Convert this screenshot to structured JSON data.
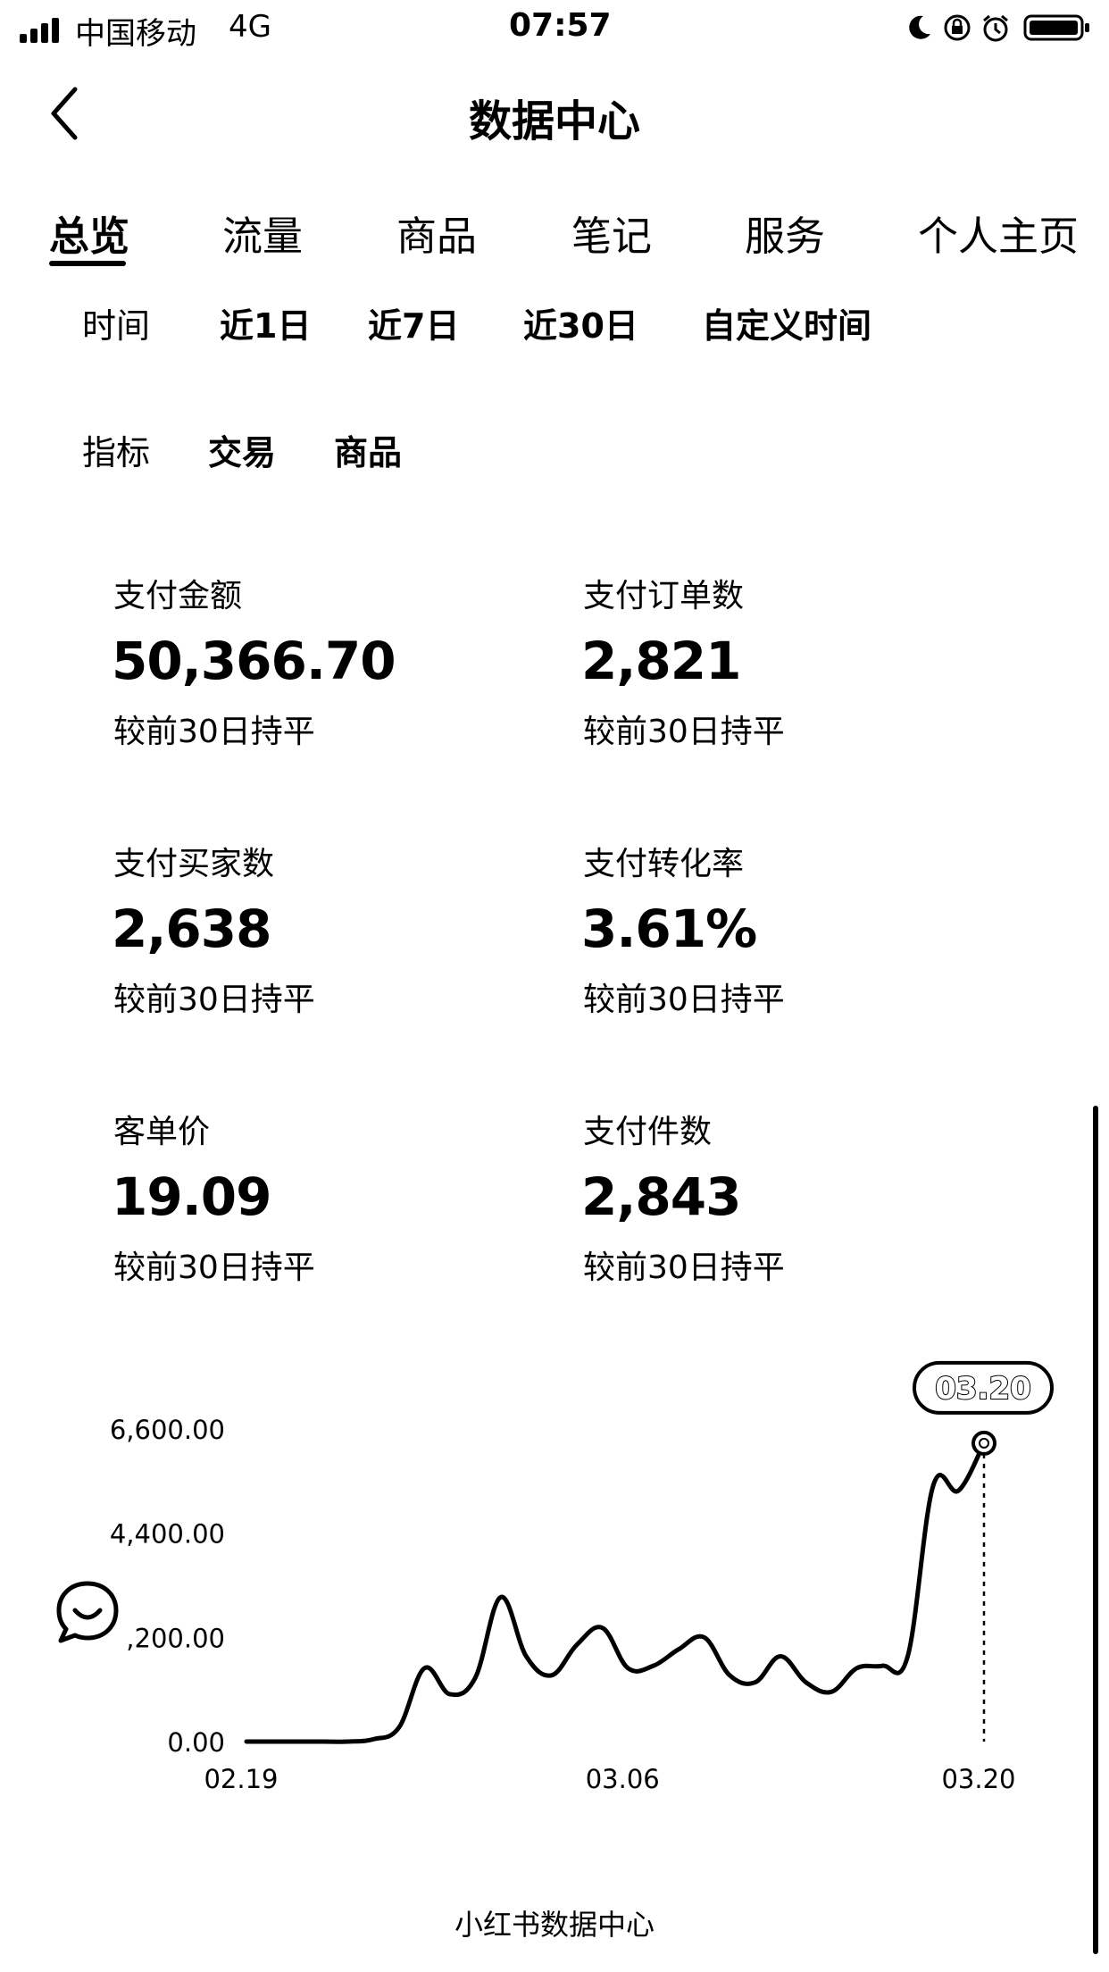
{
  "status_bar": {
    "carrier": "中国移动",
    "network": "4G",
    "time": "07:57",
    "icons": [
      "signal-icon",
      "moon-icon",
      "rotation-lock-icon",
      "alarm-icon",
      "battery-icon"
    ]
  },
  "nav": {
    "back_icon": "chevron-left-icon",
    "title": "数据中心"
  },
  "tabs": [
    {
      "label": "总览",
      "active": true
    },
    {
      "label": "流量",
      "active": false
    },
    {
      "label": "商品",
      "active": false
    },
    {
      "label": "笔记",
      "active": false
    },
    {
      "label": "服务",
      "active": false
    },
    {
      "label": "个人主页",
      "active": false
    }
  ],
  "time_filter": {
    "label": "时间",
    "options": [
      "近1日",
      "近7日",
      "近30日",
      "自定义时间"
    ]
  },
  "indicator_filter": {
    "label": "指标",
    "options": [
      "交易",
      "商品"
    ]
  },
  "metrics": [
    {
      "label": "支付金额",
      "value": "50,366.70",
      "comparison": "较前30日持平"
    },
    {
      "label": "支付订单数",
      "value": "2,821",
      "comparison": "较前30日持平"
    },
    {
      "label": "支付买家数",
      "value": "2,638",
      "comparison": "较前30日持平"
    },
    {
      "label": "支付转化率",
      "value": "3.61%",
      "comparison": "较前30日持平"
    },
    {
      "label": "客单价",
      "value": "19.09",
      "comparison": "较前30日持平"
    },
    {
      "label": "支付件数",
      "value": "2,843",
      "comparison": "较前30日持平"
    }
  ],
  "chart_data": {
    "type": "line",
    "y_tick_labels": [
      "0.00",
      ",200.00",
      "4,400.00",
      "6,600.00"
    ],
    "y_ticks": [
      0,
      2200,
      4400,
      6600
    ],
    "ylim": [
      0,
      6600
    ],
    "x_tick_labels": [
      "02.19",
      "03.06",
      "03.20"
    ],
    "x": [
      "02.19",
      "02.20",
      "02.21",
      "02.22",
      "02.23",
      "02.24",
      "02.25",
      "02.26",
      "02.27",
      "02.28",
      "03.01",
      "03.02",
      "03.03",
      "03.04",
      "03.05",
      "03.06",
      "03.07",
      "03.08",
      "03.09",
      "03.10",
      "03.11",
      "03.12",
      "03.13",
      "03.14",
      "03.15",
      "03.16",
      "03.17",
      "03.18",
      "03.19",
      "03.20"
    ],
    "series": [
      {
        "values": [
          0,
          0,
          0,
          0,
          0,
          50,
          300,
          1550,
          1000,
          1350,
          3050,
          1800,
          1400,
          2050,
          2400,
          1550,
          1600,
          1950,
          2200,
          1400,
          1250,
          1800,
          1250,
          1050,
          1550,
          1600,
          1800,
          5400,
          5300,
          6300
        ]
      }
    ],
    "tooltip": "03.20",
    "highlight_x": "03.20",
    "grid": false,
    "legend": "none"
  },
  "chat_icon": "chat-bubble-icon",
  "footer": "小红书数据中心"
}
